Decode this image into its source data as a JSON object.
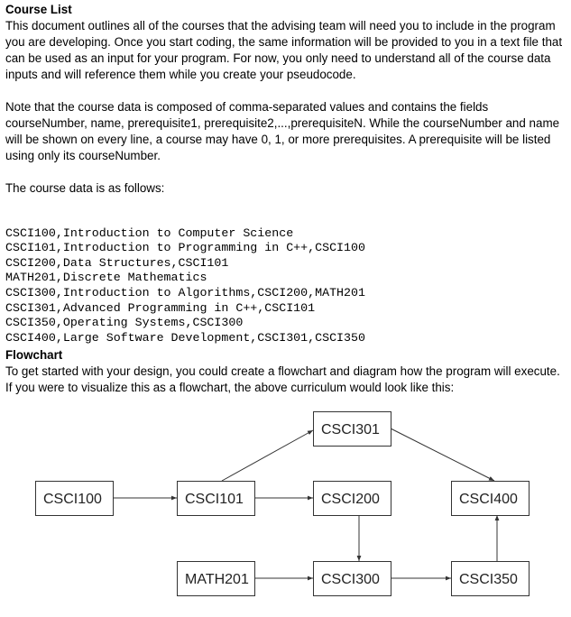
{
  "course_list": {
    "heading": "Course List",
    "intro": "This document outlines all of the courses that the advising team will need you to include in the program you are developing. Once you start coding, the same information will be provided to you in a text file that can be used as an input for your program. For now, you only need to understand all of the course data inputs and will reference them while you create your pseudocode.",
    "note": "Note that the course data is composed of comma-separated values and contains the fields courseNumber, name, prerequisite1, prerequisite2,...,prerequisiteN. While the courseNumber and name will be shown on every line, a course may have 0, 1, or more prerequisites. A prerequisite will be listed using only its courseNumber.",
    "data_intro": "The course data is as follows:",
    "lines": [
      "CSCI100,Introduction to Computer Science",
      "CSCI101,Introduction to Programming in C++,CSCI100",
      "CSCI200,Data Structures,CSCI101",
      "MATH201,Discrete Mathematics",
      "CSCI300,Introduction to Algorithms,CSCI200,MATH201",
      "CSCI301,Advanced Programming in C++,CSCI101",
      "CSCI350,Operating Systems,CSCI300",
      "CSCI400,Large Software Development,CSCI301,CSCI350"
    ]
  },
  "flowchart": {
    "heading": "Flowchart",
    "intro": "To get started with your design, you could create a flowchart and diagram how the program will execute. If you were to visualize this as a flowchart, the above curriculum would look like this:",
    "nodes": [
      {
        "id": "CSCI100",
        "label": "CSCI100"
      },
      {
        "id": "CSCI101",
        "label": "CSCI101"
      },
      {
        "id": "CSCI200",
        "label": "CSCI200"
      },
      {
        "id": "CSCI301",
        "label": "CSCI301"
      },
      {
        "id": "CSCI400",
        "label": "CSCI400"
      },
      {
        "id": "MATH201",
        "label": "MATH201"
      },
      {
        "id": "CSCI300",
        "label": "CSCI300"
      },
      {
        "id": "CSCI350",
        "label": "CSCI350"
      }
    ],
    "edges": [
      {
        "from": "CSCI100",
        "to": "CSCI101"
      },
      {
        "from": "CSCI101",
        "to": "CSCI200"
      },
      {
        "from": "CSCI101",
        "to": "CSCI301"
      },
      {
        "from": "CSCI301",
        "to": "CSCI400"
      },
      {
        "from": "CSCI200",
        "to": "CSCI300"
      },
      {
        "from": "MATH201",
        "to": "CSCI300"
      },
      {
        "from": "CSCI300",
        "to": "CSCI350"
      },
      {
        "from": "CSCI350",
        "to": "CSCI400"
      }
    ]
  }
}
